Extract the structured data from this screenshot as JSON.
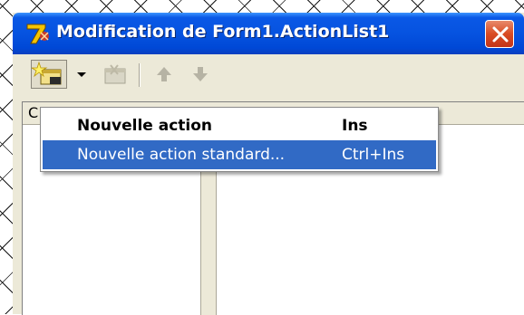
{
  "window": {
    "title": "Modification de Form1.ActionList1"
  },
  "toolbar": {
    "new_action_icon": "new-action-icon",
    "dropdown_icon": "dropdown-arrow-icon",
    "delete_icon": "delete-icon",
    "up_icon": "arrow-up-icon",
    "down_icon": "arrow-down-icon"
  },
  "list_header": {
    "fragment": "C"
  },
  "menu": {
    "items": [
      {
        "label": "Nouvelle action",
        "shortcut": "Ins"
      },
      {
        "label": "Nouvelle action standard...",
        "shortcut": "Ctrl+Ins"
      }
    ]
  },
  "colors": {
    "titlebar": "#0653e0",
    "highlight": "#316ac5",
    "face": "#ece9d8",
    "close": "#d94b22"
  }
}
